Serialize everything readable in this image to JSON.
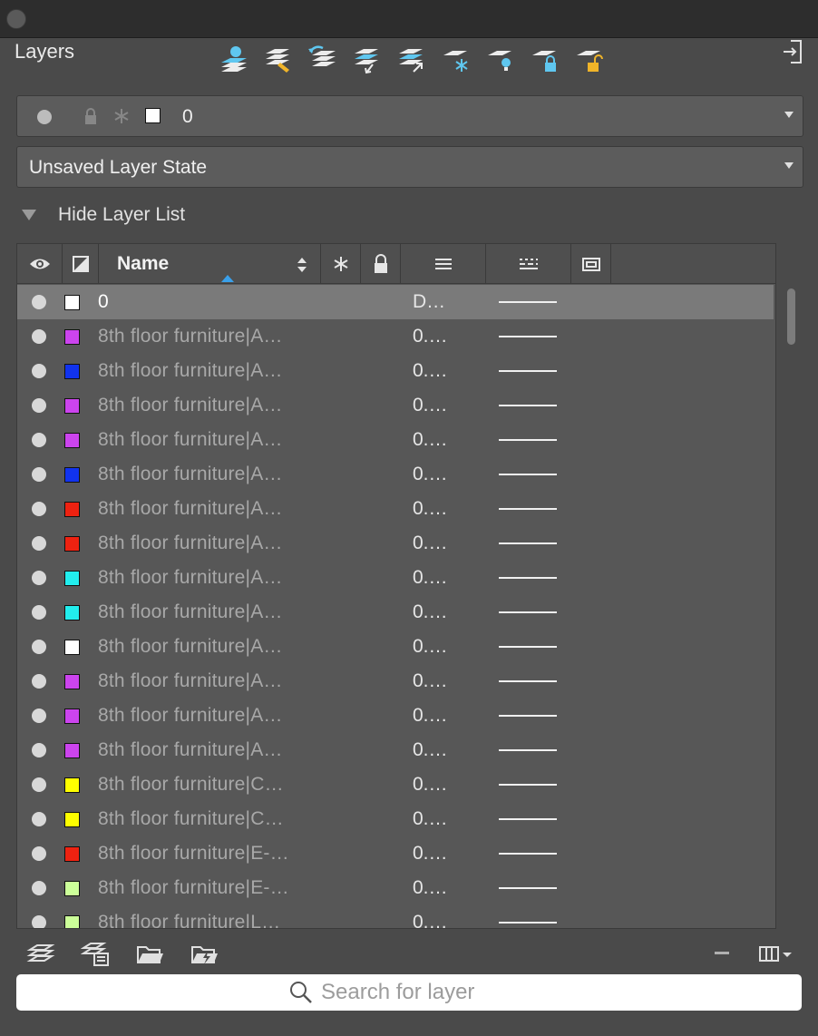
{
  "panel": {
    "title": "Layers"
  },
  "current_layer": {
    "name": "0",
    "color": "#ffffff"
  },
  "layer_state": {
    "value": "Unsaved Layer State"
  },
  "list_toggle": {
    "label": "Hide Layer List"
  },
  "columns": {
    "name": "Name"
  },
  "rows": [
    {
      "name": "0",
      "color": "#ffffff",
      "lineweight": "D…",
      "selected": true
    },
    {
      "name": "8th floor furniture|A…",
      "color": "#cc44ee",
      "lineweight": "0.…"
    },
    {
      "name": "8th floor furniture|A…",
      "color": "#1133ee",
      "lineweight": "0.…"
    },
    {
      "name": "8th floor furniture|A…",
      "color": "#cc44ee",
      "lineweight": "0.…"
    },
    {
      "name": "8th floor furniture|A…",
      "color": "#cc44ee",
      "lineweight": "0.…"
    },
    {
      "name": "8th floor furniture|A…",
      "color": "#1133ee",
      "lineweight": "0.…"
    },
    {
      "name": "8th floor furniture|A…",
      "color": "#ee2211",
      "lineweight": "0.…"
    },
    {
      "name": "8th floor furniture|A…",
      "color": "#ee2211",
      "lineweight": "0.…"
    },
    {
      "name": "8th floor furniture|A…",
      "color": "#22eeee",
      "lineweight": "0.…"
    },
    {
      "name": "8th floor furniture|A…",
      "color": "#22eeee",
      "lineweight": "0.…"
    },
    {
      "name": "8th floor furniture|A…",
      "color": "#ffffff",
      "lineweight": "0.…"
    },
    {
      "name": "8th floor furniture|A…",
      "color": "#cc44ee",
      "lineweight": "0.…"
    },
    {
      "name": "8th floor furniture|A…",
      "color": "#cc44ee",
      "lineweight": "0.…"
    },
    {
      "name": "8th floor furniture|A…",
      "color": "#cc44ee",
      "lineweight": "0.…"
    },
    {
      "name": "8th floor furniture|C…",
      "color": "#ffff00",
      "lineweight": "0.…"
    },
    {
      "name": "8th floor furniture|C…",
      "color": "#ffff00",
      "lineweight": "0.…"
    },
    {
      "name": "8th floor furniture|E-…",
      "color": "#ee2211",
      "lineweight": "0.…"
    },
    {
      "name": "8th floor furniture|E-…",
      "color": "#ccff99",
      "lineweight": "0.…"
    },
    {
      "name": "8th floor furniture|L…",
      "color": "#ccff99",
      "lineweight": "0.…"
    }
  ],
  "search": {
    "placeholder": "Search for layer"
  },
  "colors": {
    "accent": "#3aa0ea",
    "icon_blue": "#5fc7f0",
    "icon_gold": "#f0b429"
  }
}
